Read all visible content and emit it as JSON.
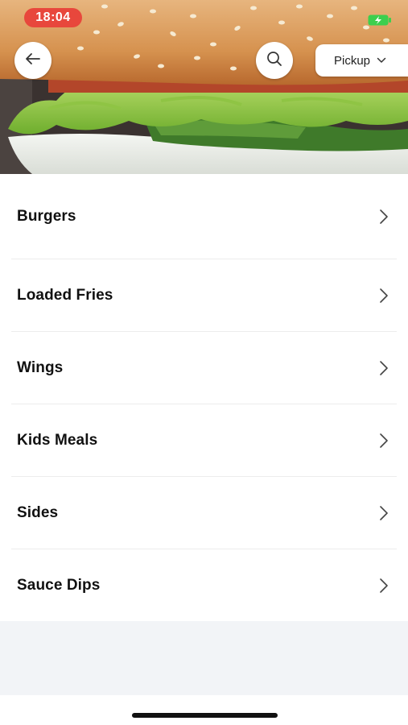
{
  "status": {
    "time": "18:04"
  },
  "header": {
    "back_icon": "arrow-left-icon",
    "search_icon": "search-icon",
    "order_mode": "Pickup"
  },
  "categories": [
    {
      "label": "Burgers"
    },
    {
      "label": "Loaded Fries"
    },
    {
      "label": "Wings"
    },
    {
      "label": "Kids Meals"
    },
    {
      "label": "Sides"
    },
    {
      "label": "Sauce Dips"
    }
  ],
  "colors": {
    "status_pill": "#e8473c",
    "battery": "#3ccf4e",
    "footer_bg": "#f2f4f7"
  }
}
